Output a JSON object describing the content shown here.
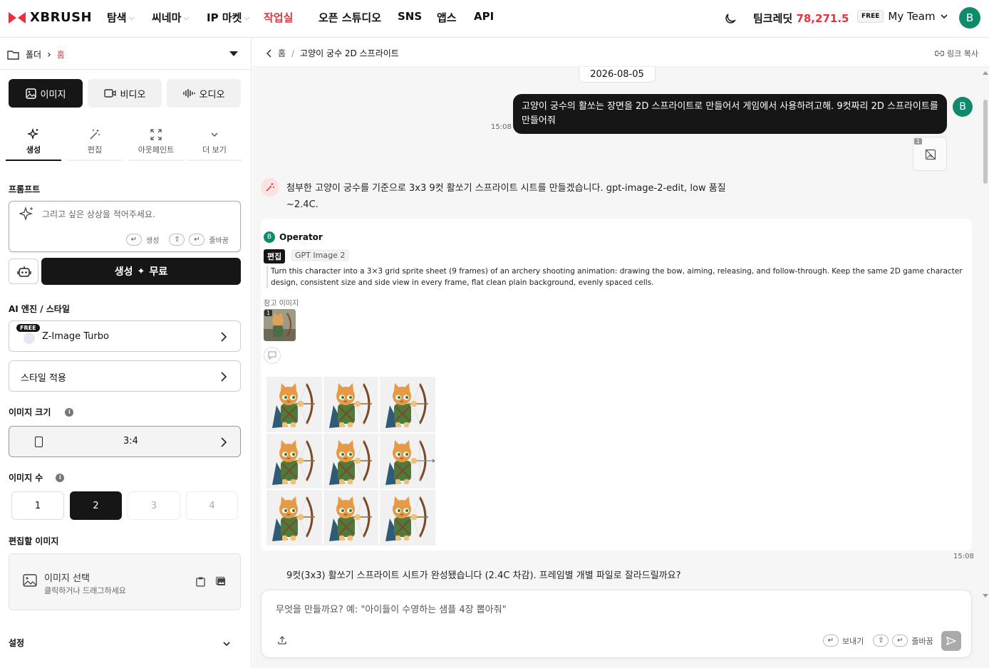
{
  "header": {
    "brand": "XBRUSH",
    "nav": [
      {
        "label": "탐색",
        "chevron": true
      },
      {
        "label": "씨네마",
        "chevron": true
      },
      {
        "label": "IP 마켓",
        "chevron": true
      },
      {
        "label": "작업실",
        "chevron": false,
        "active": true
      },
      {
        "label": "오픈 스튜디오",
        "chevron": false
      },
      {
        "label": "SNS",
        "chevron": false
      },
      {
        "label": "앱스",
        "chevron": false
      },
      {
        "label": "API",
        "chevron": false
      }
    ],
    "credit_label": "팀크레딧",
    "credit_value": "78,271.5",
    "plan_badge": "FREE",
    "team_name": "My Team",
    "avatar_letter": "B"
  },
  "sidebar": {
    "folder_label": "폴더",
    "folder_current": "홈",
    "media_tabs": [
      "이미지",
      "비디오",
      "오디오"
    ],
    "mode_tabs": [
      "생성",
      "편집",
      "아웃페인트",
      "더 보기"
    ],
    "prompt_label": "프롬프트",
    "prompt_placeholder": "그리고 싶은 상상을 적어주세요.",
    "hint_generate": "생성",
    "hint_newline": "줄바꿈",
    "generate_button": "생성",
    "generate_free": "무료",
    "engine_label": "AI 엔진 / 스타일",
    "engine_badge": "FREE",
    "engine_name": "Z-Image Turbo",
    "style_apply": "스타일 적용",
    "size_label": "이미지 크기",
    "size_value": "3:4",
    "count_label": "이미지 수",
    "counts": [
      "1",
      "2",
      "3",
      "4"
    ],
    "count_selected": 2,
    "edit_image_label": "편집할 이미지",
    "image_select_title": "이미지 선택",
    "image_select_sub": "클릭하거나 드래그하세요",
    "settings_label": "설정"
  },
  "main": {
    "breadcrumb_home": "홈",
    "breadcrumb_title": "고양이 궁수 2D 스프라이트",
    "copy_link": "링크 복사",
    "date": "2026-08-05",
    "user_message": "고양이 궁수의 활쏘는 장면을 2D 스프라이트로 만들어서 게임에서 사용하려고해. 9컷짜리 2D 스프라이트를 만들어줘",
    "user_time": "15:08",
    "user_avatar": "B",
    "attach_count": "1",
    "assistant_intro_line1": "첨부한 고양이 궁수를 기준으로 3x3 9컷 활쏘기 스프라이트 시트를 만들겠습니다. gpt-image-2-edit, low 품질",
    "assistant_intro_line2": "~2.4C.",
    "operator_letter": "B",
    "operator_name": "Operator",
    "tag_edit": "편집",
    "tag_model": "GPT Image 2",
    "operator_prompt": "Turn this character into a 3×3 grid sprite sheet (9 frames) of an archery shooting animation: drawing the bow, aiming, releasing, and follow-through. Keep the same 2D game character design, consistent size and side view in every frame, flat clean plain background, evenly spaced cells.",
    "ref_label": "참고 이미지",
    "ref_index": "1",
    "result_time": "15:08",
    "assistant_followup": "9컷(3x3) 활쏘기 스프라이트 시트가 완성됐습니다 (2.4C 차감). 프레임별 개별 파일로 잘라드릴까요?",
    "chat_placeholder": "무엇을 만들까요? 예: \"아이들이 수영하는 샘플 4장 뽑아줘\"",
    "hint_send": "보내기",
    "hint_newline": "줄바꿈"
  },
  "colors": {
    "brand_red": "#e8313b",
    "dark": "#161616",
    "avatar_green": "#0f8a6c"
  }
}
